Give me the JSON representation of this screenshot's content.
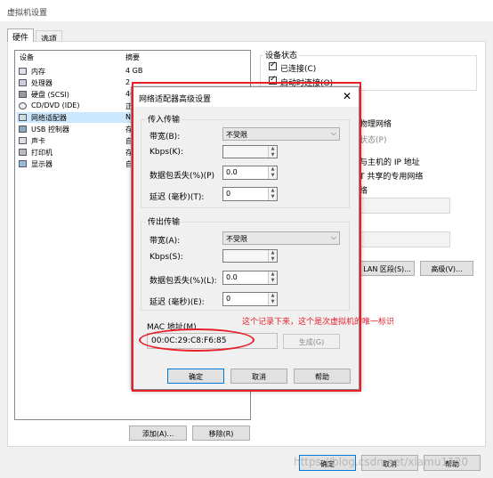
{
  "window": {
    "title": "虚拟机设置"
  },
  "tabs": [
    {
      "label": "硬件"
    },
    {
      "label": "选项"
    }
  ],
  "device_list": {
    "col_device": "设备",
    "col_summary": "摘要",
    "rows": [
      {
        "name": "内存",
        "summary": "4 GB",
        "icon": "memory-icon"
      },
      {
        "name": "处理器",
        "summary": "2",
        "icon": "cpu-icon"
      },
      {
        "name": "硬盘 (SCSI)",
        "summary": "40",
        "icon": "harddisk-icon"
      },
      {
        "name": "CD/DVD (IDE)",
        "summary": "正",
        "icon": "cdrom-icon"
      },
      {
        "name": "网络适配器",
        "summary": "NA",
        "icon": "network-adapter-icon",
        "selected": true
      },
      {
        "name": "USB 控制器",
        "summary": "存",
        "icon": "usb-icon"
      },
      {
        "name": "声卡",
        "summary": "自",
        "icon": "sound-icon"
      },
      {
        "name": "打印机",
        "summary": "存",
        "icon": "printer-icon"
      },
      {
        "name": "显示器",
        "summary": "自",
        "icon": "display-icon"
      }
    ],
    "add_button": "添加(A)...",
    "remove_button": "移除(R)"
  },
  "right_panel": {
    "device_status_title": "设备状态",
    "connected_label": "已连接(C)",
    "connect_at_power_on_label": "启动时连接(O)",
    "physical_net_partial": "物理网络",
    "state_partial": "状态(P)",
    "host_ip_partial": "与主机的 IP 地址",
    "shared_net_partial": "T 共享的专用网络",
    "net_partial": "络",
    "lan_segment_button": "LAN 区段(S)...",
    "advanced_button": "高级(V)..."
  },
  "footer": {
    "ok": "确定",
    "cancel": "取消",
    "help": "帮助"
  },
  "dialog": {
    "title": "网络适配器高级设置",
    "close_glyph": "✕",
    "incoming_group": "传入传输",
    "outgoing_group": "传出传输",
    "in_bandwidth_label": "带宽(B):",
    "in_bandwidth_value": "不受限",
    "in_kbps_label": "Kbps(K):",
    "in_kbps_value": "",
    "in_loss_label": "数据包丢失(%)(P)",
    "in_loss_value": "0.0",
    "in_latency_label": "延迟 (毫秒)(T):",
    "in_latency_value": "0",
    "out_bandwidth_label": "带宽(A):",
    "out_bandwidth_value": "不受限",
    "out_kbps_label": "Kbps(S):",
    "out_kbps_value": "",
    "out_loss_label": "数据包丢失(%)(L):",
    "out_loss_value": "0.0",
    "out_latency_label": "延迟 (毫秒)(E):",
    "out_latency_value": "0",
    "mac_label": "MAC 地址(M)",
    "mac_value": "00:0C:29:C8:F6:85",
    "generate_button": "生成(G)",
    "ok": "确定",
    "cancel": "取消",
    "help": "帮助"
  },
  "annotation": {
    "note": "这个记录下来，这个是次虚拟机的唯一标识",
    "color": "#e8202a"
  },
  "watermark": "https://blog.csdn.net/xiamu1120"
}
